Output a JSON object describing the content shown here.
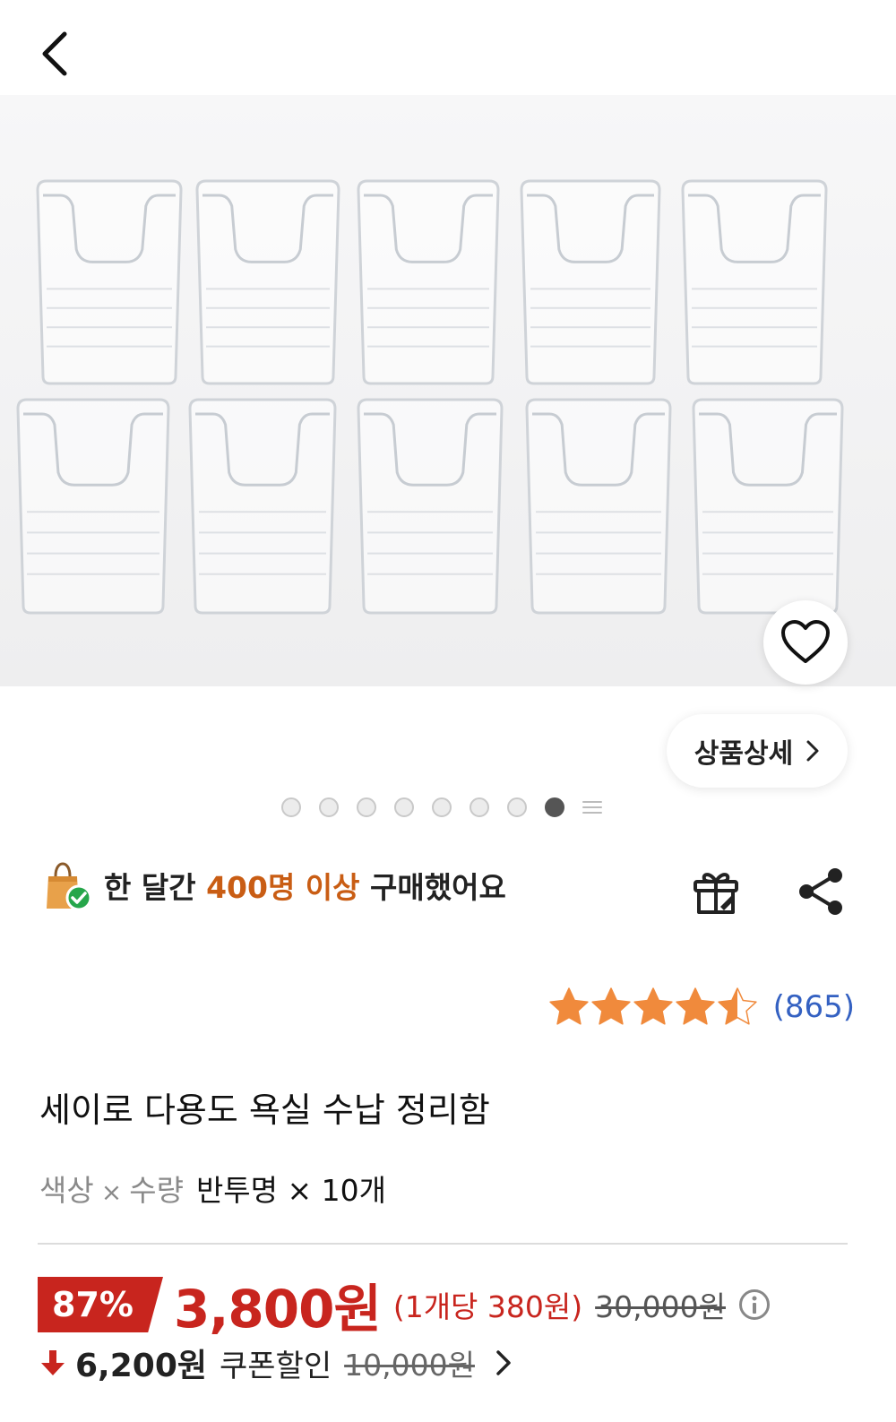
{
  "header": {
    "back_icon": "chevron-left-icon"
  },
  "gallery": {
    "image_desc_icon": "product-image",
    "total_dots": 8,
    "active_dot": 8,
    "wish_icon": "heart-icon",
    "detail_label": "상품상세"
  },
  "purchase": {
    "prefix": "한 달간 ",
    "highlight": "400명 이상",
    "suffix": " 구매했어요",
    "bag_icon": "shopping-bag-check-icon",
    "gift_icon": "gift-icon",
    "share_icon": "share-icon"
  },
  "rating": {
    "stars": 4.5,
    "count": "(865)",
    "color": "#f08a3c"
  },
  "product": {
    "title": "세이로 다용도 욕실 수납 정리함",
    "option_label_1": "색상",
    "option_label_2": "수량",
    "option_value": "반투명 × 10개"
  },
  "price": {
    "discount": "87%",
    "sale_price": "3,800원",
    "unit_price": "(1개당 380원)",
    "original_price": "30,000원",
    "accent_color": "#c8251e"
  },
  "coupon": {
    "amount": "6,200원",
    "label": "쿠폰할인",
    "original": "10,000원"
  }
}
